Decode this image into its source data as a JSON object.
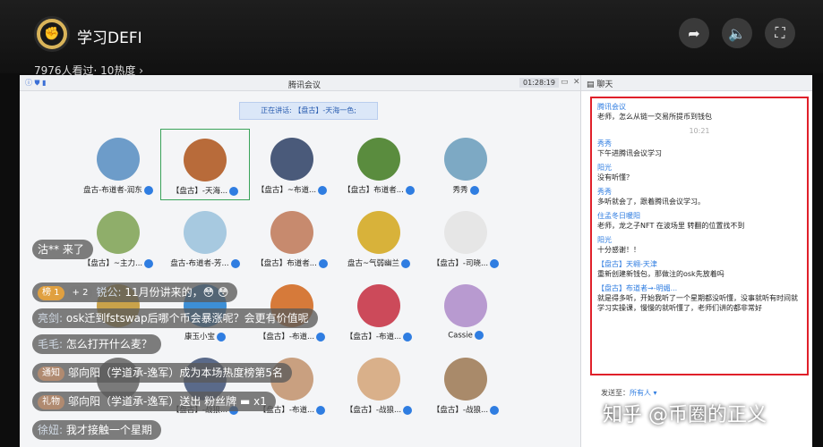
{
  "stream": {
    "title": "学习DEFI",
    "viewer_stats": "7976人看过· 10热度 ›"
  },
  "meeting": {
    "window_title": "腾讯会议",
    "timer": "01:28:19",
    "speaking_label": "正在讲话: 【盘古】-天海一色;",
    "tiles": [
      {
        "name": "盘古-布道者-润东",
        "color": "#6d9cc9"
      },
      {
        "name": "【盘古】-天海...",
        "color": "#b86b3a",
        "active": true
      },
      {
        "name": "【盘古】~布道...",
        "color": "#4a5a7a"
      },
      {
        "name": "【盘古】布道者...",
        "color": "#5a8c3e"
      },
      {
        "name": "秀秀",
        "color": "#7da9c4"
      },
      {
        "name": "【盘古】~主力...",
        "color": "#8fae6a"
      },
      {
        "name": "盘古-布道者-芳...",
        "color": "#a7c9e0"
      },
      {
        "name": "【盘古】布道者...",
        "color": "#c78a6e"
      },
      {
        "name": "盘古~气弱幽兰",
        "color": "#d8b23a"
      },
      {
        "name": "【盘古】-司晓...",
        "color": "#e6e6e6"
      },
      {
        "name": "",
        "color": "#c9a24a"
      },
      {
        "name": "康玉小宝",
        "color": "#3d8fd6"
      },
      {
        "name": "【盘古】-布道...",
        "color": "#d67a3a"
      },
      {
        "name": "【盘古】-布道...",
        "color": "#cc4a5a"
      },
      {
        "name": "Cassie",
        "color": "#b89ad0"
      },
      {
        "name": "",
        "color": "#7a7a7a"
      },
      {
        "name": "【盘古】-战狼...",
        "color": "#5a6a8a"
      },
      {
        "name": "【盘古】-布道...",
        "color": "#c9a080"
      },
      {
        "name": "【盘古】-战狼...",
        "color": "#d9b08a"
      },
      {
        "name": "【盘古】-战狼...",
        "color": "#a98a6a"
      }
    ]
  },
  "chat": {
    "header": "聊天",
    "messages": [
      {
        "name": "腾讯会议",
        "text": "老师，怎么从链一交易所提币到钱包"
      },
      {
        "time": "10:21"
      },
      {
        "name": "秀秀",
        "text": "下午进腾讯会议学习"
      },
      {
        "name": "阳光",
        "text": "没有听懂？"
      },
      {
        "name": "秀秀",
        "text": "多听就会了，跟着腾讯会议学习。"
      },
      {
        "name": "住孟冬日暖阳",
        "text": "老师，龙之子NFT 在波场里 转翻的位置找不到"
      },
      {
        "name": "阳光",
        "text": "十分感谢！！"
      },
      {
        "name": "【盘古】天翱-天津",
        "text": "重新创建新钱包，那做注的osk先放着吗"
      },
      {
        "name": "【盘古】布道者→-明媚...",
        "text": "就是得多听，开始我听了一个星期都没听懂，没事就听有时间就学习实操课，慢慢的就听懂了，老师们讲的都非常好"
      }
    ],
    "send_to_label": "发送至：",
    "send_to_value": "所有人 ▾"
  },
  "danmaku": [
    {
      "user": "",
      "text": "沽** 来了",
      "tag": "",
      "tag_color": ""
    },
    {
      "user": "锐公: ",
      "text": "11月份讲来的，😳 😳",
      "tag": "榜 1",
      "tag_color": "#e0a040",
      "tag2": "+ 2",
      "tag2_color": "#7a7a7a"
    },
    {
      "user": "亮剑: ",
      "text": "osk迁到fstswap后哪个币会暴涨呢？会更有价值呢",
      "tag": "",
      "tag_color": ""
    },
    {
      "user": "毛毛: ",
      "text": "怎么打开什么麦？",
      "tag": "",
      "tag_color": ""
    },
    {
      "user": "",
      "text": "邬向阳（学道承-逸军）成为本场热度榜第5名",
      "tag": "通知",
      "tag_color": "#b08a70"
    },
    {
      "user": "",
      "text": "邬向阳（学道承-逸军）送出 粉丝牌 ▬ x1",
      "tag": "礼物",
      "tag_color": "#b08a70"
    },
    {
      "user": "徐妞: ",
      "text": "我才接触一个星期",
      "tag": "",
      "tag_color": ""
    }
  ],
  "watermark": "知乎 @币圈的正义"
}
